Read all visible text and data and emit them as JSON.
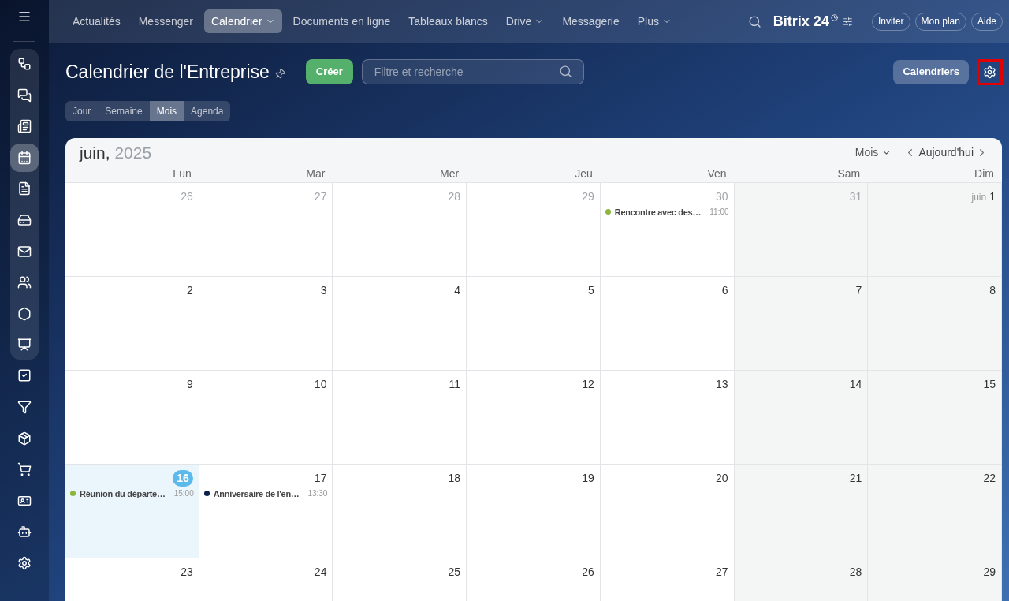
{
  "top_nav": {
    "items": [
      {
        "label": "Actualités",
        "selected": false,
        "dropdown": false
      },
      {
        "label": "Messenger",
        "selected": false,
        "dropdown": false
      },
      {
        "label": "Calendrier",
        "selected": true,
        "dropdown": true
      },
      {
        "label": "Documents en ligne",
        "selected": false,
        "dropdown": false
      },
      {
        "label": "Tableaux blancs",
        "selected": false,
        "dropdown": false
      },
      {
        "label": "Drive",
        "selected": false,
        "dropdown": true
      },
      {
        "label": "Messagerie",
        "selected": false,
        "dropdown": false
      },
      {
        "label": "Plus",
        "selected": false,
        "dropdown": true
      }
    ],
    "brand": "Bitrix 24",
    "buttons": [
      "Inviter",
      "Mon plan",
      "Aide"
    ]
  },
  "sidebar": {
    "pinned_items": [
      {
        "selected": false
      },
      {
        "selected": false
      },
      {
        "selected": false
      },
      {
        "selected": true
      },
      {
        "selected": false
      },
      {
        "selected": false
      },
      {
        "selected": false
      },
      {
        "selected": false
      },
      {
        "selected": false
      },
      {
        "selected": false
      }
    ],
    "items": [
      {
        "selected": false
      },
      {
        "selected": false
      },
      {
        "selected": false
      },
      {
        "selected": false
      },
      {
        "selected": false
      },
      {
        "selected": false
      }
    ]
  },
  "header": {
    "title": "Calendrier de l'Entreprise",
    "create_button": "Créer",
    "search": {
      "placeholder": "Filtre et recherche"
    },
    "calendars_button": "Calendriers",
    "settings_button": {
      "highlighted": true
    }
  },
  "view_tabs": [
    {
      "label": "Jour",
      "selected": false
    },
    {
      "label": "Semaine",
      "selected": false
    },
    {
      "label": "Mois",
      "selected": true
    },
    {
      "label": "Agenda",
      "selected": false
    }
  ],
  "calendar": {
    "month": "juin,",
    "year": "2025",
    "view_select": "Mois",
    "today_button": "Aujourd'hui",
    "weekdays": [
      "Lun",
      "Mar",
      "Mer",
      "Jeu",
      "Ven",
      "Sam",
      "Dim"
    ],
    "weeks": [
      {
        "days": [
          {
            "number": "26",
            "muted": true,
            "today": false
          },
          {
            "number": "27",
            "muted": true,
            "today": false
          },
          {
            "number": "28",
            "muted": true,
            "today": false
          },
          {
            "number": "29",
            "muted": true,
            "today": false
          },
          {
            "number": "30",
            "muted": true,
            "today": false,
            "events": [
              {
                "title": "Rencontre avec des…",
                "time": "11:00",
                "color": "#8db63c"
              }
            ]
          },
          {
            "number": "31",
            "muted": true,
            "today": false
          },
          {
            "month": "juin",
            "number": "1",
            "muted": false,
            "today": false
          }
        ]
      },
      {
        "days": [
          {
            "number": "2",
            "muted": false,
            "today": false
          },
          {
            "number": "3",
            "muted": false,
            "today": false
          },
          {
            "number": "4",
            "muted": false,
            "today": false
          },
          {
            "number": "5",
            "muted": false,
            "today": false
          },
          {
            "number": "6",
            "muted": false,
            "today": false
          },
          {
            "number": "7",
            "muted": false,
            "today": false
          },
          {
            "number": "8",
            "muted": false,
            "today": false
          }
        ]
      },
      {
        "days": [
          {
            "number": "9",
            "muted": false,
            "today": false
          },
          {
            "number": "10",
            "muted": false,
            "today": false
          },
          {
            "number": "11",
            "muted": false,
            "today": false
          },
          {
            "number": "12",
            "muted": false,
            "today": false
          },
          {
            "number": "13",
            "muted": false,
            "today": false
          },
          {
            "number": "14",
            "muted": false,
            "today": false
          },
          {
            "number": "15",
            "muted": false,
            "today": false
          }
        ]
      },
      {
        "days": [
          {
            "number": "16",
            "muted": false,
            "today": true,
            "events": [
              {
                "title": "Réunion du départe…",
                "time": "15:00",
                "color": "#8db63c"
              }
            ]
          },
          {
            "number": "17",
            "muted": false,
            "today": false,
            "events": [
              {
                "title": "Anniversaire de l'en…",
                "time": "13:30",
                "color": "#0d1f4d"
              }
            ]
          },
          {
            "number": "18",
            "muted": false,
            "today": false
          },
          {
            "number": "19",
            "muted": false,
            "today": false
          },
          {
            "number": "20",
            "muted": false,
            "today": false
          },
          {
            "number": "21",
            "muted": false,
            "today": false
          },
          {
            "number": "22",
            "muted": false,
            "today": false
          }
        ]
      },
      {
        "days": [
          {
            "number": "23",
            "muted": false,
            "today": false
          },
          {
            "number": "24",
            "muted": false,
            "today": false
          },
          {
            "number": "25",
            "muted": false,
            "today": false
          },
          {
            "number": "26",
            "muted": false,
            "today": false
          },
          {
            "number": "27",
            "muted": false,
            "today": false
          },
          {
            "number": "28",
            "muted": false,
            "today": false
          },
          {
            "number": "29",
            "muted": false,
            "today": false
          }
        ]
      }
    ]
  }
}
